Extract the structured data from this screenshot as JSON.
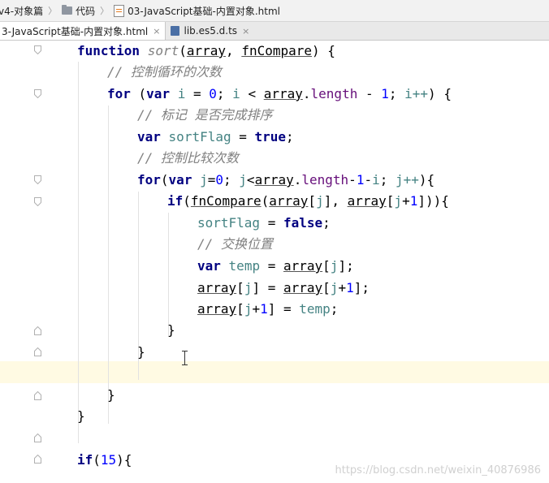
{
  "breadcrumbs": {
    "project": "v4-对象篇",
    "folder": "代码",
    "file": "03-JavaScript基础-内置对象.html"
  },
  "tabs": [
    {
      "label": "3-JavaScript基础-内置对象.html",
      "close": "×"
    },
    {
      "label": "lib.es5.d.ts",
      "close": "×"
    }
  ],
  "code": {
    "l1": {
      "kw": "function",
      "name": "sort",
      "p1": "array",
      "p2": "fnCompare"
    },
    "l2": {
      "comment": "// 控制循环的次数"
    },
    "l3": {
      "kw": "for",
      "kw2": "var",
      "var": "i",
      "zero": "0",
      "var2": "i",
      "arr": "array",
      "prop": "length",
      "one": "1",
      "inc": "i++"
    },
    "l4": {
      "comment": "// 标记 是否完成排序"
    },
    "l5": {
      "kw": "var",
      "var": "sortFlag",
      "val": "true"
    },
    "l6": {
      "comment": "// 控制比较次数"
    },
    "l7": {
      "kw": "for",
      "kw2": "var",
      "var": "j",
      "zero": "0",
      "var2": "j",
      "arr": "array",
      "prop": "length",
      "one": "1",
      "i": "i",
      "inc": "j++"
    },
    "l8": {
      "kw": "if",
      "fn": "fnCompare",
      "arr": "array",
      "j": "j",
      "arr2": "array",
      "j2": "j",
      "one": "1"
    },
    "l9": {
      "var": "sortFlag",
      "val": "false"
    },
    "l10": {
      "comment": "// 交换位置"
    },
    "l11": {
      "kw": "var",
      "var": "temp",
      "arr": "array",
      "j": "j"
    },
    "l12": {
      "arr": "array",
      "j": "j",
      "arr2": "array",
      "j2": "j",
      "one": "1"
    },
    "l13": {
      "arr": "array",
      "j": "j",
      "one": "1",
      "var": "temp"
    },
    "l19": {
      "kw": "if",
      "num": "15"
    }
  },
  "watermark": "https://blog.csdn.net/weixin_40876986",
  "colors": {
    "keyword": "#000080",
    "comment": "#808080",
    "number": "#0000ff",
    "local": "#458383",
    "property": "#660e7a",
    "current_line": "#fffae3"
  }
}
